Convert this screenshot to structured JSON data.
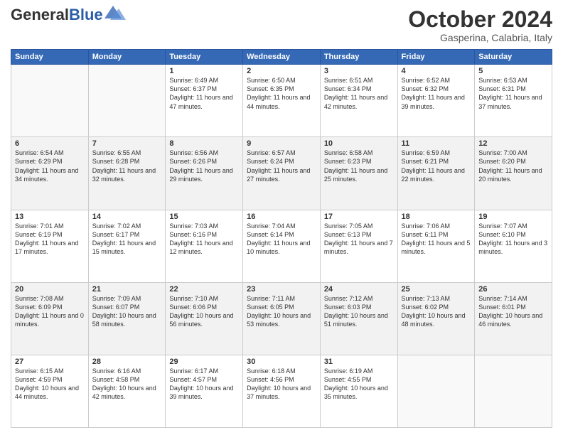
{
  "header": {
    "logo_general": "General",
    "logo_blue": "Blue",
    "month_title": "October 2024",
    "location": "Gasperina, Calabria, Italy"
  },
  "weekdays": [
    "Sunday",
    "Monday",
    "Tuesday",
    "Wednesday",
    "Thursday",
    "Friday",
    "Saturday"
  ],
  "weeks": [
    [
      {
        "day": "",
        "info": ""
      },
      {
        "day": "",
        "info": ""
      },
      {
        "day": "1",
        "info": "Sunrise: 6:49 AM\nSunset: 6:37 PM\nDaylight: 11 hours and 47 minutes."
      },
      {
        "day": "2",
        "info": "Sunrise: 6:50 AM\nSunset: 6:35 PM\nDaylight: 11 hours and 44 minutes."
      },
      {
        "day": "3",
        "info": "Sunrise: 6:51 AM\nSunset: 6:34 PM\nDaylight: 11 hours and 42 minutes."
      },
      {
        "day": "4",
        "info": "Sunrise: 6:52 AM\nSunset: 6:32 PM\nDaylight: 11 hours and 39 minutes."
      },
      {
        "day": "5",
        "info": "Sunrise: 6:53 AM\nSunset: 6:31 PM\nDaylight: 11 hours and 37 minutes."
      }
    ],
    [
      {
        "day": "6",
        "info": "Sunrise: 6:54 AM\nSunset: 6:29 PM\nDaylight: 11 hours and 34 minutes."
      },
      {
        "day": "7",
        "info": "Sunrise: 6:55 AM\nSunset: 6:28 PM\nDaylight: 11 hours and 32 minutes."
      },
      {
        "day": "8",
        "info": "Sunrise: 6:56 AM\nSunset: 6:26 PM\nDaylight: 11 hours and 29 minutes."
      },
      {
        "day": "9",
        "info": "Sunrise: 6:57 AM\nSunset: 6:24 PM\nDaylight: 11 hours and 27 minutes."
      },
      {
        "day": "10",
        "info": "Sunrise: 6:58 AM\nSunset: 6:23 PM\nDaylight: 11 hours and 25 minutes."
      },
      {
        "day": "11",
        "info": "Sunrise: 6:59 AM\nSunset: 6:21 PM\nDaylight: 11 hours and 22 minutes."
      },
      {
        "day": "12",
        "info": "Sunrise: 7:00 AM\nSunset: 6:20 PM\nDaylight: 11 hours and 20 minutes."
      }
    ],
    [
      {
        "day": "13",
        "info": "Sunrise: 7:01 AM\nSunset: 6:19 PM\nDaylight: 11 hours and 17 minutes."
      },
      {
        "day": "14",
        "info": "Sunrise: 7:02 AM\nSunset: 6:17 PM\nDaylight: 11 hours and 15 minutes."
      },
      {
        "day": "15",
        "info": "Sunrise: 7:03 AM\nSunset: 6:16 PM\nDaylight: 11 hours and 12 minutes."
      },
      {
        "day": "16",
        "info": "Sunrise: 7:04 AM\nSunset: 6:14 PM\nDaylight: 11 hours and 10 minutes."
      },
      {
        "day": "17",
        "info": "Sunrise: 7:05 AM\nSunset: 6:13 PM\nDaylight: 11 hours and 7 minutes."
      },
      {
        "day": "18",
        "info": "Sunrise: 7:06 AM\nSunset: 6:11 PM\nDaylight: 11 hours and 5 minutes."
      },
      {
        "day": "19",
        "info": "Sunrise: 7:07 AM\nSunset: 6:10 PM\nDaylight: 11 hours and 3 minutes."
      }
    ],
    [
      {
        "day": "20",
        "info": "Sunrise: 7:08 AM\nSunset: 6:09 PM\nDaylight: 11 hours and 0 minutes."
      },
      {
        "day": "21",
        "info": "Sunrise: 7:09 AM\nSunset: 6:07 PM\nDaylight: 10 hours and 58 minutes."
      },
      {
        "day": "22",
        "info": "Sunrise: 7:10 AM\nSunset: 6:06 PM\nDaylight: 10 hours and 56 minutes."
      },
      {
        "day": "23",
        "info": "Sunrise: 7:11 AM\nSunset: 6:05 PM\nDaylight: 10 hours and 53 minutes."
      },
      {
        "day": "24",
        "info": "Sunrise: 7:12 AM\nSunset: 6:03 PM\nDaylight: 10 hours and 51 minutes."
      },
      {
        "day": "25",
        "info": "Sunrise: 7:13 AM\nSunset: 6:02 PM\nDaylight: 10 hours and 48 minutes."
      },
      {
        "day": "26",
        "info": "Sunrise: 7:14 AM\nSunset: 6:01 PM\nDaylight: 10 hours and 46 minutes."
      }
    ],
    [
      {
        "day": "27",
        "info": "Sunrise: 6:15 AM\nSunset: 4:59 PM\nDaylight: 10 hours and 44 minutes."
      },
      {
        "day": "28",
        "info": "Sunrise: 6:16 AM\nSunset: 4:58 PM\nDaylight: 10 hours and 42 minutes."
      },
      {
        "day": "29",
        "info": "Sunrise: 6:17 AM\nSunset: 4:57 PM\nDaylight: 10 hours and 39 minutes."
      },
      {
        "day": "30",
        "info": "Sunrise: 6:18 AM\nSunset: 4:56 PM\nDaylight: 10 hours and 37 minutes."
      },
      {
        "day": "31",
        "info": "Sunrise: 6:19 AM\nSunset: 4:55 PM\nDaylight: 10 hours and 35 minutes."
      },
      {
        "day": "",
        "info": ""
      },
      {
        "day": "",
        "info": ""
      }
    ]
  ]
}
